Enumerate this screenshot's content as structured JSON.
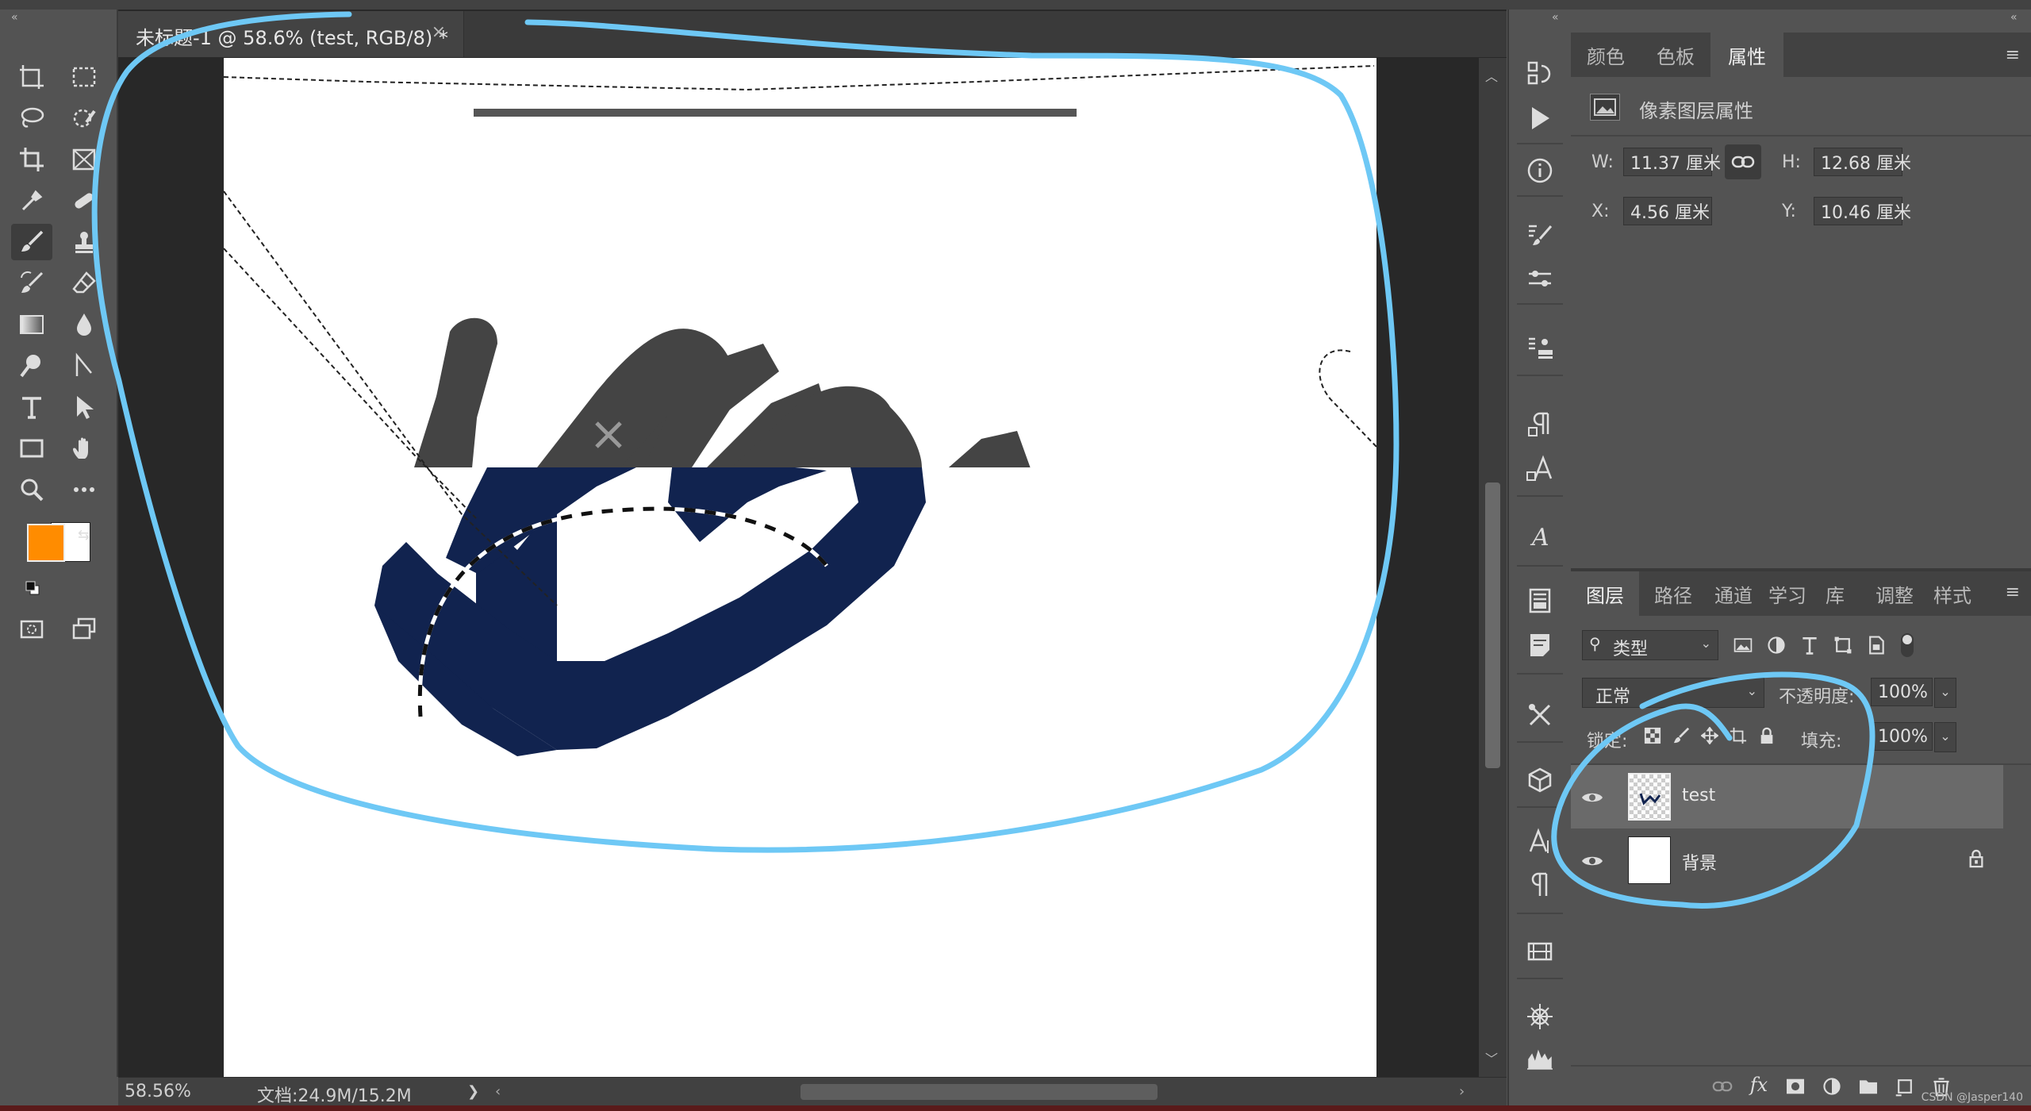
{
  "document_tab": {
    "title": "未标题-1 @ 58.6% (test, RGB/8) *",
    "close_glyph": "×"
  },
  "status": {
    "zoom": "58.56%",
    "doc_info": "文档:24.9M/15.2M",
    "arrow": "❯"
  },
  "colors": {
    "foreground": "#ff8c00",
    "background": "#ffffff",
    "ink_dark": "#11234f",
    "ink_gray": "#444444",
    "annotation": "#6ec8f5"
  },
  "tools": [
    "artboard-icon",
    "rect-marquee-icon",
    "lasso-icon",
    "quick-select-icon",
    "crop-icon",
    "frame-icon",
    "eyedropper-icon",
    "healing-brush-icon",
    "brush-icon",
    "stamp-icon",
    "history-brush-icon",
    "eraser-icon",
    "gradient-icon",
    "blur-icon",
    "dodge-icon",
    "pen-icon",
    "type-icon",
    "path-select-icon",
    "rectangle-icon",
    "hand-icon",
    "zoom-icon",
    "more-icon"
  ],
  "properties_panel": {
    "tabs": [
      "颜色",
      "色板",
      "属性"
    ],
    "active_tab": "属性",
    "header": "像素图层属性",
    "w_label": "W:",
    "w_value": "11.37 厘米",
    "h_label": "H:",
    "h_value": "12.68 厘米",
    "x_label": "X:",
    "x_value": "4.56 厘米",
    "y_label": "Y:",
    "y_value": "10.46 厘米"
  },
  "layers_panel": {
    "tabs": [
      "图层",
      "路径",
      "通道",
      "学习",
      "库",
      "调整",
      "样式"
    ],
    "active_tab": "图层",
    "filter_label": "类型",
    "blend_mode": "正常",
    "opacity_label": "不透明度:",
    "opacity_value": "100%",
    "lock_label": "锁定:",
    "fill_label": "填充:",
    "fill_value": "100%",
    "layers": [
      {
        "name": "test",
        "selected": true
      },
      {
        "name": "背景",
        "locked": true
      }
    ]
  },
  "footer_icons": [
    "link-layers-icon",
    "fx-icon",
    "mask-icon",
    "adjustment-icon",
    "group-icon",
    "new-layer-icon",
    "delete-icon"
  ],
  "fx_label": "fx",
  "watermark": "CSDN @Jasper140"
}
